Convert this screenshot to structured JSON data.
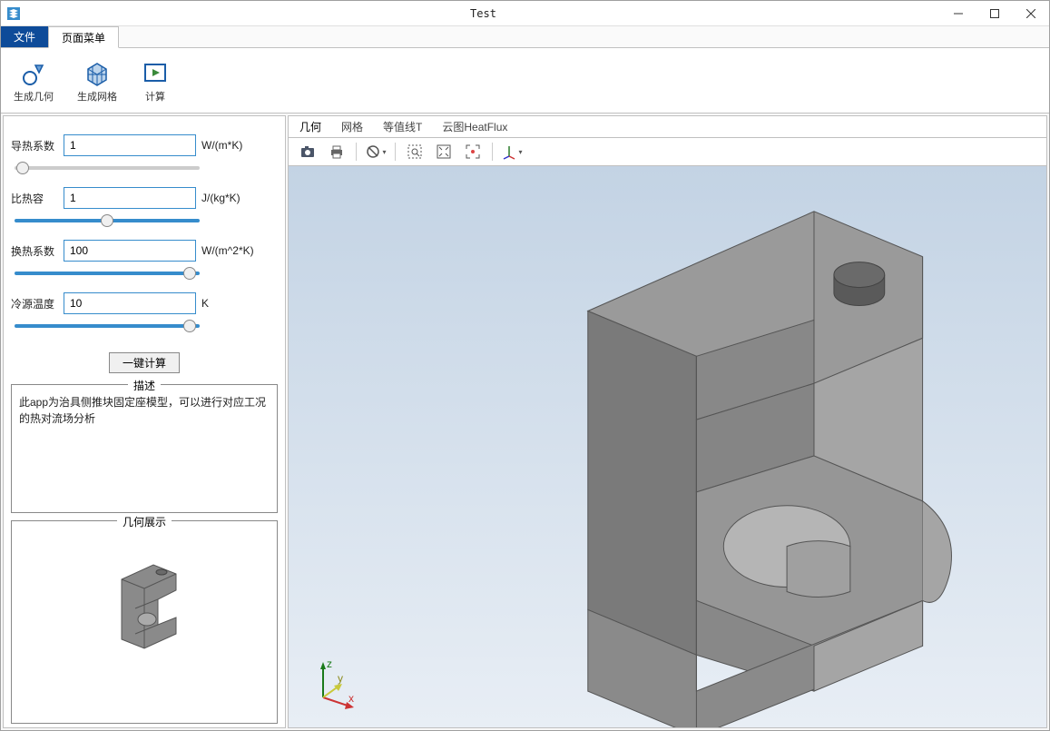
{
  "window": {
    "title": "Test"
  },
  "ribbon": {
    "file_tab": "文件",
    "active_tab": "页面菜单",
    "buttons": {
      "genGeom": "生成几何",
      "genMesh": "生成网格",
      "compute": "计算"
    }
  },
  "params": {
    "thermalConductivity": {
      "label": "导热系数",
      "value": "1",
      "unit": "W/(m*K)"
    },
    "specificHeat": {
      "label": "比热容",
      "value": "1",
      "unit": "J/(kg*K)"
    },
    "heatTransferCoeff": {
      "label": "换热系数",
      "value": "100",
      "unit": "W/(m^2*K)"
    },
    "coldSourceTemp": {
      "label": "冷源温度",
      "value": "10",
      "unit": "K"
    }
  },
  "calcButton": "一键计算",
  "descSection": {
    "legend": "描述",
    "text": "此app为治具侧推块固定座模型，可以进行对应工况的热对流场分析"
  },
  "geomSection": {
    "legend": "几何展示"
  },
  "viewTabs": {
    "geom": "几何",
    "mesh": "网格",
    "isolineT": "等值线T",
    "heatflux": "云图HeatFlux"
  },
  "axes": {
    "x": "x",
    "y": "y",
    "z": "z"
  }
}
